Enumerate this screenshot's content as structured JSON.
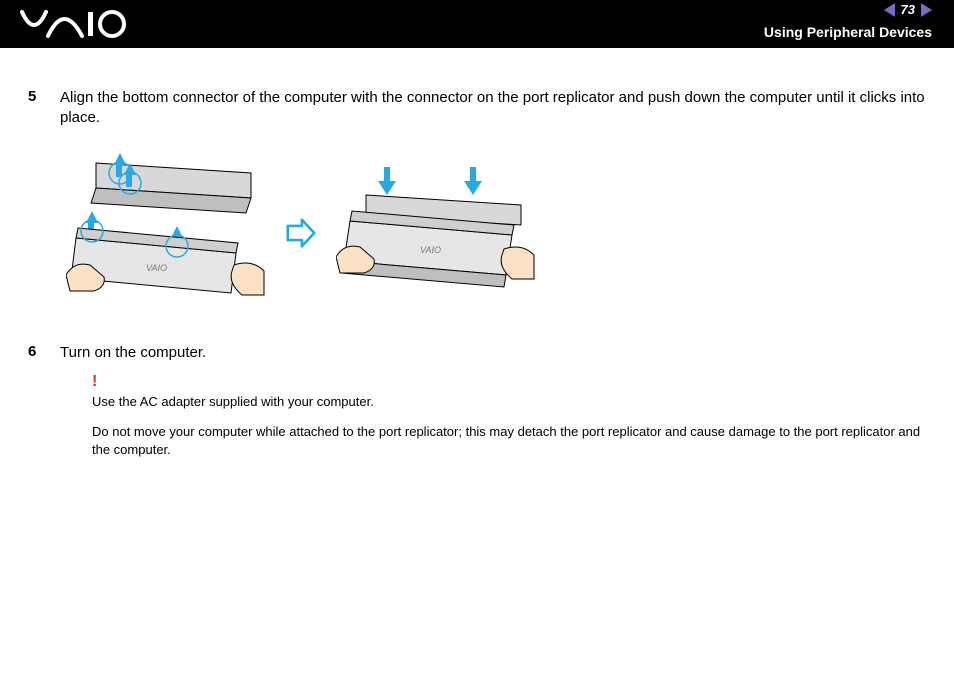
{
  "header": {
    "page_number": "73",
    "section_title": "Using Peripheral Devices"
  },
  "steps": [
    {
      "number": "5",
      "text": "Align the bottom connector of the computer with the connector on the port replicator and push down the computer until it clicks into place."
    },
    {
      "number": "6",
      "text": "Turn on the computer."
    }
  ],
  "notes": {
    "warn_symbol": "!",
    "line1": "Use the AC adapter supplied with your computer.",
    "line2": "Do not move your computer while attached to the port replicator; this may detach the port replicator and cause damage to the port replicator and the computer."
  }
}
